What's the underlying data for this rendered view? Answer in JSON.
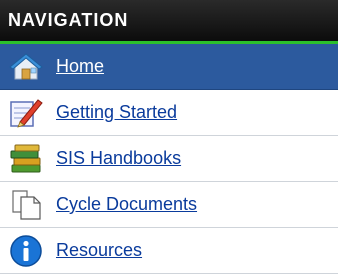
{
  "navigation": {
    "title": "NAVIGATION",
    "accent_color": "#2cc02c",
    "active_color": "#2c5a9e",
    "items": [
      {
        "label": "Home",
        "icon": "home-icon",
        "active": true
      },
      {
        "label": "Getting Started",
        "icon": "pencil-notepad-icon",
        "active": false
      },
      {
        "label": "SIS Handbooks",
        "icon": "books-stack-icon",
        "active": false
      },
      {
        "label": "Cycle Documents",
        "icon": "documents-icon",
        "active": false
      },
      {
        "label": "Resources",
        "icon": "info-icon",
        "active": false
      }
    ]
  }
}
